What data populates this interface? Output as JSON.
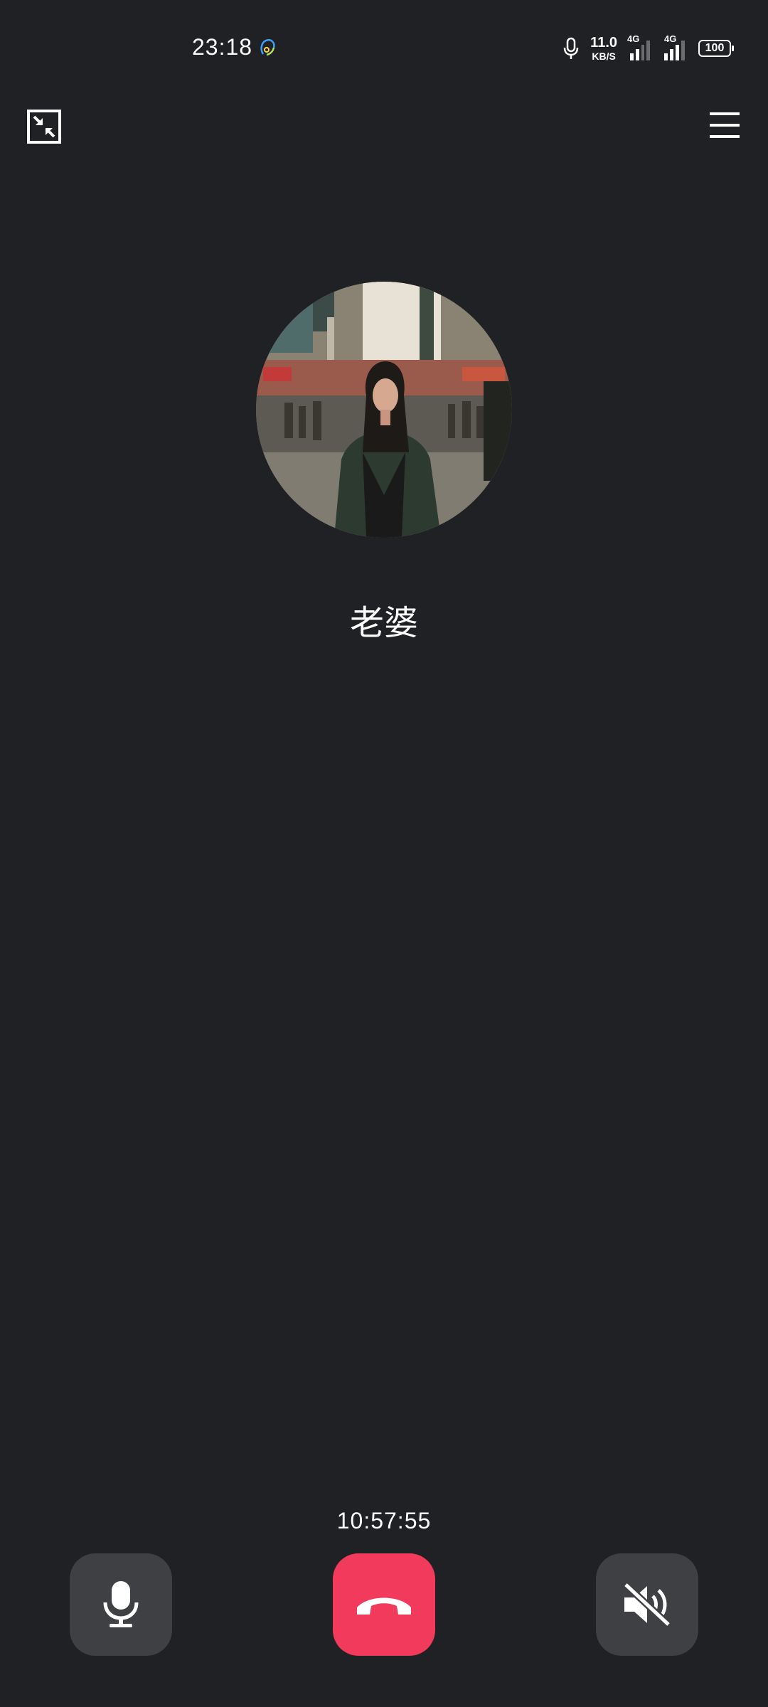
{
  "status_bar": {
    "time": "23:18",
    "net_speed_value": "11.0",
    "net_speed_unit": "KB/S",
    "sim1_label": "4G",
    "sim2_label": "4G",
    "battery": "100",
    "icons": [
      "call-app-icon",
      "mic-status-icon",
      "signal-icon",
      "battery-icon"
    ]
  },
  "header": {
    "minimize_icon": "minimize-icon",
    "menu_icon": "menu-icon"
  },
  "contact": {
    "name": "老婆",
    "avatar_icon": "avatar-photo"
  },
  "call": {
    "timer": "10:57:55",
    "controls": [
      {
        "name": "microphone",
        "icon": "microphone-icon"
      },
      {
        "name": "hang-up",
        "icon": "phone-hangup-icon"
      },
      {
        "name": "speaker-muted",
        "icon": "speaker-mute-icon"
      }
    ]
  },
  "colors": {
    "background": "#202124",
    "button": "#3f4043",
    "hangup": "#f23a5c"
  }
}
